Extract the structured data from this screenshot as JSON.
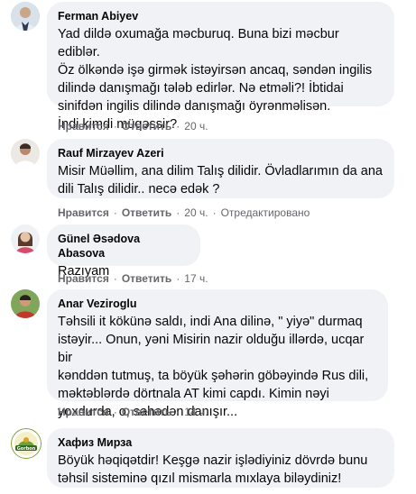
{
  "actions": {
    "like": "Нравится",
    "reply": "Ответить",
    "dot": "·",
    "edited": "Отредактировано"
  },
  "comments": [
    {
      "author": "Ferman Abiyev",
      "text": "Yad dildə oxumağa məcburuq. Buna bizi məcbur ediblər.\nÖz ölkəndə işə girmək istəyirsən ancaq, səndən ingilis\ndilində danışmağı tələb edirlər. Nə etməli?! İbtidai\nsinifdən ingilis dilində danışmağı öyrənməlisən.\nİndi kimdi müqəssir?",
      "time": "20 ч."
    },
    {
      "author": "Rauf Mirzayev Azeri",
      "text": "Misir Müəllim, ana dilim Talış dilidir. Övladlarımın da ana\ndili Talış dilidir.. necə edək ?",
      "time": "20 ч."
    },
    {
      "author": "Günel Əsədova Abasova",
      "text": "Razıyam",
      "time": "17 ч."
    },
    {
      "author": "Anar Veziroglu",
      "text": "Təhsili it kökünə saldı, indi Ana dilinə, \" yiyə\" durmaq\nistəyir... Onun, yəni Misirin nazir olduğu illərdə, ucqar bir\nkənddən tutmuş, ta böyük şəhərin göbəyində Rus dili,\nməktəblərdə dörtnala AT kimi capdı. Kimin nəyi\nyoxdurda, o, sahədən danışır...",
      "time": "14 ч."
    },
    {
      "author": "Хафиз Мирза",
      "text": "Böyük həqiqətdir! Keşgə nazir işlədiyiniz dövrdə bunu\ntəhsil sisteminə qızıl mismarla mıxlaya biləydiniz!",
      "avatar_text": "Gorbon"
    }
  ],
  "colors": {
    "bubble": "#f0f2f5",
    "meta": "#65676b",
    "text": "#050505"
  }
}
